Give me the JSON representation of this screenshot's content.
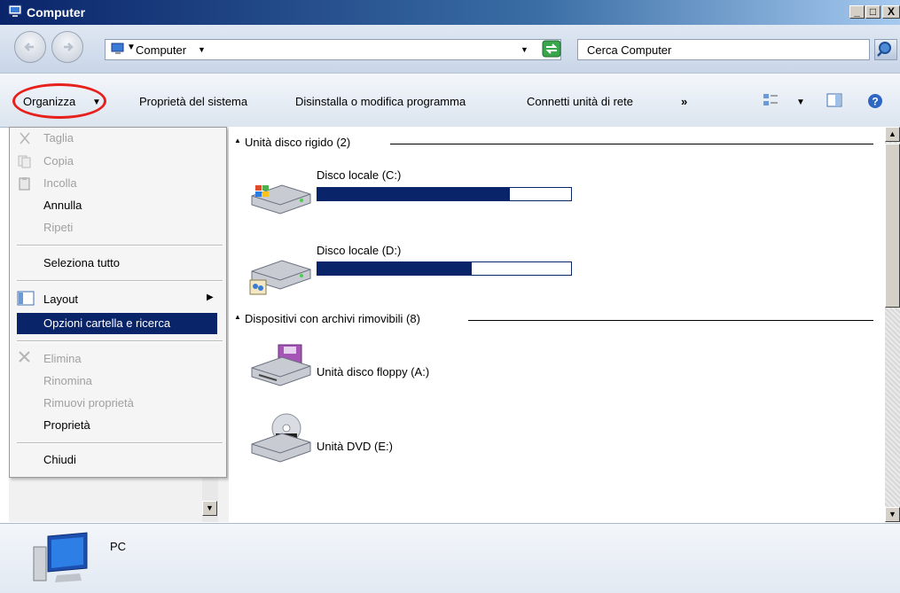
{
  "window": {
    "title": "Computer"
  },
  "address": {
    "path": "Computer"
  },
  "search": {
    "placeholder": "Cerca Computer"
  },
  "toolbar": {
    "organize": "Organizza",
    "system_properties": "Proprietà del sistema",
    "uninstall": "Disinstalla o modifica programma",
    "map_drive": "Connetti unità di rete",
    "more": "»"
  },
  "menu": {
    "cut": "Taglia",
    "copy": "Copia",
    "paste": "Incolla",
    "undo": "Annulla",
    "redo": "Ripeti",
    "select_all": "Seleziona tutto",
    "layout": "Layout",
    "folder_options": "Opzioni cartella e ricerca",
    "delete": "Elimina",
    "rename": "Rinomina",
    "remove_properties": "Rimuovi proprietà",
    "properties": "Proprietà",
    "close": "Chiudi"
  },
  "groups": {
    "hard_disks": "Unità disco rigido (2)",
    "removable": "Dispositivi con archivi rimovibili (8)"
  },
  "drives": [
    {
      "label": "Disco locale (C:)",
      "used_fraction": 0.76
    },
    {
      "label": "Disco locale (D:)",
      "used_fraction": 0.61
    },
    {
      "label": "Unità disco floppy (A:)"
    },
    {
      "label": "Unità DVD (E:)",
      "badge": "DVD"
    }
  ],
  "details": {
    "name": "PC"
  },
  "colors": {
    "accent": "#0a246a",
    "highlight_ring": "#e8201c"
  }
}
